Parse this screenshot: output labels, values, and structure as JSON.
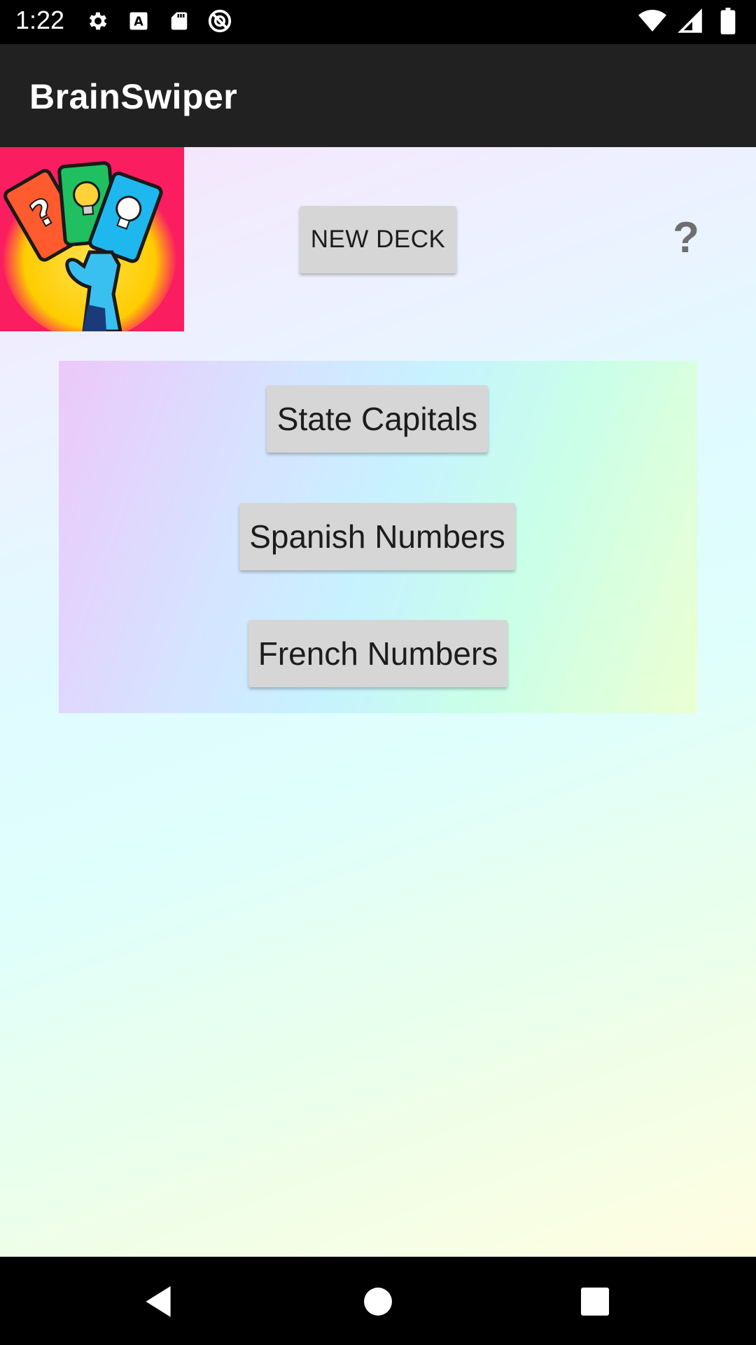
{
  "status_bar": {
    "time": "1:22",
    "left_icons": [
      "settings-icon",
      "font-a-icon",
      "sd-card-icon",
      "no-disturb-icon"
    ],
    "right_icons": [
      "wifi-icon",
      "cell-signal-icon",
      "battery-icon"
    ]
  },
  "app_bar": {
    "title": "BrainSwiper"
  },
  "header": {
    "logo": "brainswiper-logo",
    "new_deck_label": "NEW DECK",
    "help_label": "?"
  },
  "decks": [
    {
      "label": "State Capitals"
    },
    {
      "label": "Spanish Numbers"
    },
    {
      "label": "French Numbers"
    }
  ],
  "nav_bar": {
    "icons": [
      "back-icon",
      "home-icon",
      "recents-icon"
    ]
  },
  "colors": {
    "app_bar": "#212121",
    "logo_background": "#fa1d5f",
    "button": "#d6d6d6",
    "help": "#6f6f6f"
  }
}
